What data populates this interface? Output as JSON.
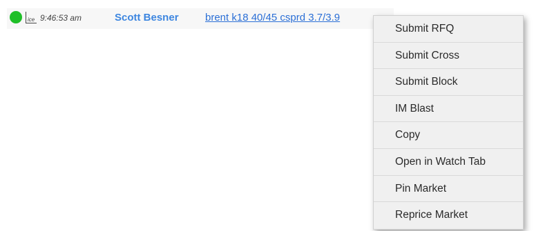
{
  "message": {
    "status_color": "#1fbf28",
    "source_icon_text": "ice",
    "timestamp": "9:46:53 am",
    "sender": "Scott Besner",
    "sender_color": "#3d86e0",
    "market_text": "brent k18 40/45 csprd 3.7/3.9",
    "link_color": "#2b6fd6"
  },
  "context_menu": {
    "items": [
      {
        "label": "Submit RFQ"
      },
      {
        "label": "Submit Cross"
      },
      {
        "label": "Submit Block"
      },
      {
        "label": "IM Blast"
      },
      {
        "label": "Copy"
      },
      {
        "label": "Open in Watch Tab"
      },
      {
        "label": "Pin Market"
      },
      {
        "label": "Reprice Market"
      }
    ]
  }
}
